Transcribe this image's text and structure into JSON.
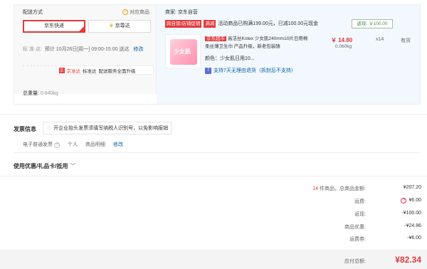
{
  "shipping": {
    "title": "配送方式",
    "dispatch_link": "对应商品",
    "btn_jd": "京东快递",
    "btn_zz": "京尊达",
    "std_label": "标 准 达:",
    "std_value": "预计 10月26日[周一] 09:00-15:00 送达",
    "modify": "修改",
    "tip_badge": "京准达",
    "tip_text1": "标准达",
    "tip_text2": "配送服务全面升级",
    "weight_label": "总重量:",
    "weight_value": "0.840kg"
  },
  "shop": {
    "name": "商家:  京东自营",
    "tag1": "跨自营/店铺促销",
    "tag2": "满减",
    "promo_text": "活动商品已购满199.00元，已减100.00元现金",
    "return_btn": "返现: ￥100.00"
  },
  "product": {
    "badge": "京东超市",
    "title": "高洁丝Kotex 少女肌240mm10片日用棉柔丝薄卫生巾 产品升级，新老包装随",
    "price": "￥ 14.80",
    "weight": "0.060kg",
    "qty": "x14",
    "stock": "有货",
    "color": "颜色：少女肌日用10...",
    "seven_icon": "7",
    "seven_text": "支持7天无理由退货（拆封后不支持）"
  },
  "invoice": {
    "title": "发票信息",
    "tip": "开企业抬头发票须填写纳税人识别号，以免影响报销",
    "type": "电子普通发票",
    "person": "个人",
    "detail": "商品明细",
    "modify": "修改"
  },
  "coupon": {
    "title": "使用优惠/礼品卡/抵用",
    "arrow": "﹀"
  },
  "summary": {
    "count": "14",
    "count_suffix": "件商品，总商品金额:",
    "goods_total": "¥207.20",
    "freight_label": "运费:",
    "freight_value": "¥6.00",
    "cashback_label": "返现:",
    "cashback_value": "-¥100.00",
    "discount_label": "商品优惠:",
    "discount_value": "-¥24.86",
    "freightcoupon_label": "运费券:",
    "freightcoupon_value": "-¥6.00",
    "total_label": "应付总额:",
    "total_value": "¥82.34"
  },
  "colors": {
    "accent": "#e4393c",
    "link": "#005ea7"
  }
}
